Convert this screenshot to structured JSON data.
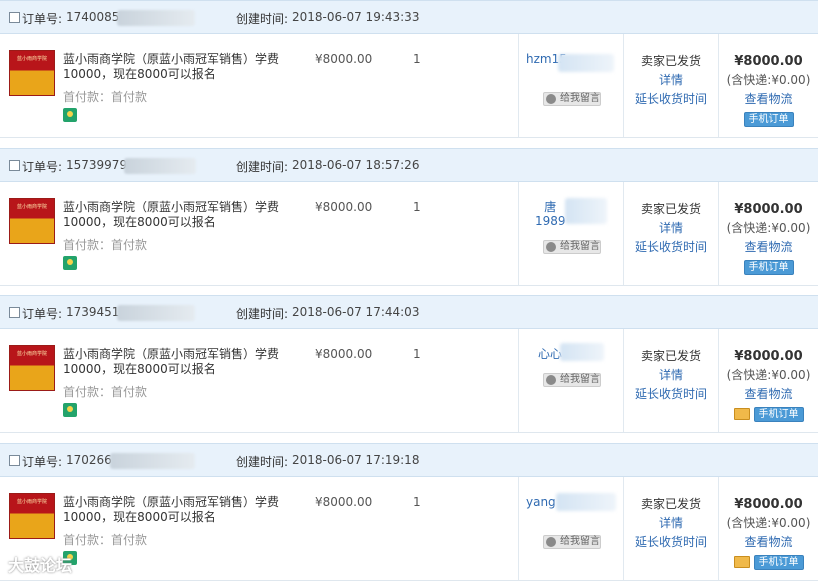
{
  "labels": {
    "order_no": "订单号:",
    "created": "创建时间:",
    "leave_message": "给我留言",
    "details": "详情",
    "extend_receipt": "延长收货时间",
    "view_logistics": "查看物流",
    "mobile_order": "手机订单",
    "deposit": "首付款：首付款",
    "thumb_text": "蓝小雨商学院"
  },
  "orders": [
    {
      "order_id": "1740085",
      "created_time": "2018-06-07 19:43:33",
      "title": "蓝小雨商学院（原蓝小雨冠军销售）学费10000，现在8000可以报名",
      "unit_price": "¥8000.00",
      "quantity": "1",
      "buyer": "hzm15",
      "status": "卖家已发货",
      "total": "¥8000.00",
      "shipping": "(含快递:¥0.00)"
    },
    {
      "order_id": "15739979",
      "created_time": "2018-06-07 18:57:26",
      "title": "蓝小雨商学院（原蓝小雨冠军销售）学费10000，现在8000可以报名",
      "unit_price": "¥8000.00",
      "quantity": "1",
      "buyer": "唐\n1989",
      "status": "卖家已发货",
      "total": "¥8000.00",
      "shipping": "(含快递:¥0.00)"
    },
    {
      "order_id": "1739451",
      "created_time": "2018-06-07 17:44:03",
      "title": "蓝小雨商学院（原蓝小雨冠军销售）学费10000，现在8000可以报名",
      "unit_price": "¥8000.00",
      "quantity": "1",
      "buyer": "心心",
      "status": "卖家已发货",
      "total": "¥8000.00",
      "shipping": "(含快递:¥0.00)"
    },
    {
      "order_id": "170266",
      "created_time": "2018-06-07 17:19:18",
      "title": "蓝小雨商学院（原蓝小雨冠军销售）学费10000，现在8000可以报名",
      "unit_price": "¥8000.00",
      "quantity": "1",
      "buyer": "yang",
      "status": "卖家已发货",
      "total": "¥8000.00",
      "shipping": "(含快递:¥0.00)"
    }
  ],
  "watermark": "大鼓论坛",
  "colors": {
    "header_bg": "#e8f2fb",
    "link": "#2f6ab1",
    "mobile_badge": "#4b9ad6"
  }
}
